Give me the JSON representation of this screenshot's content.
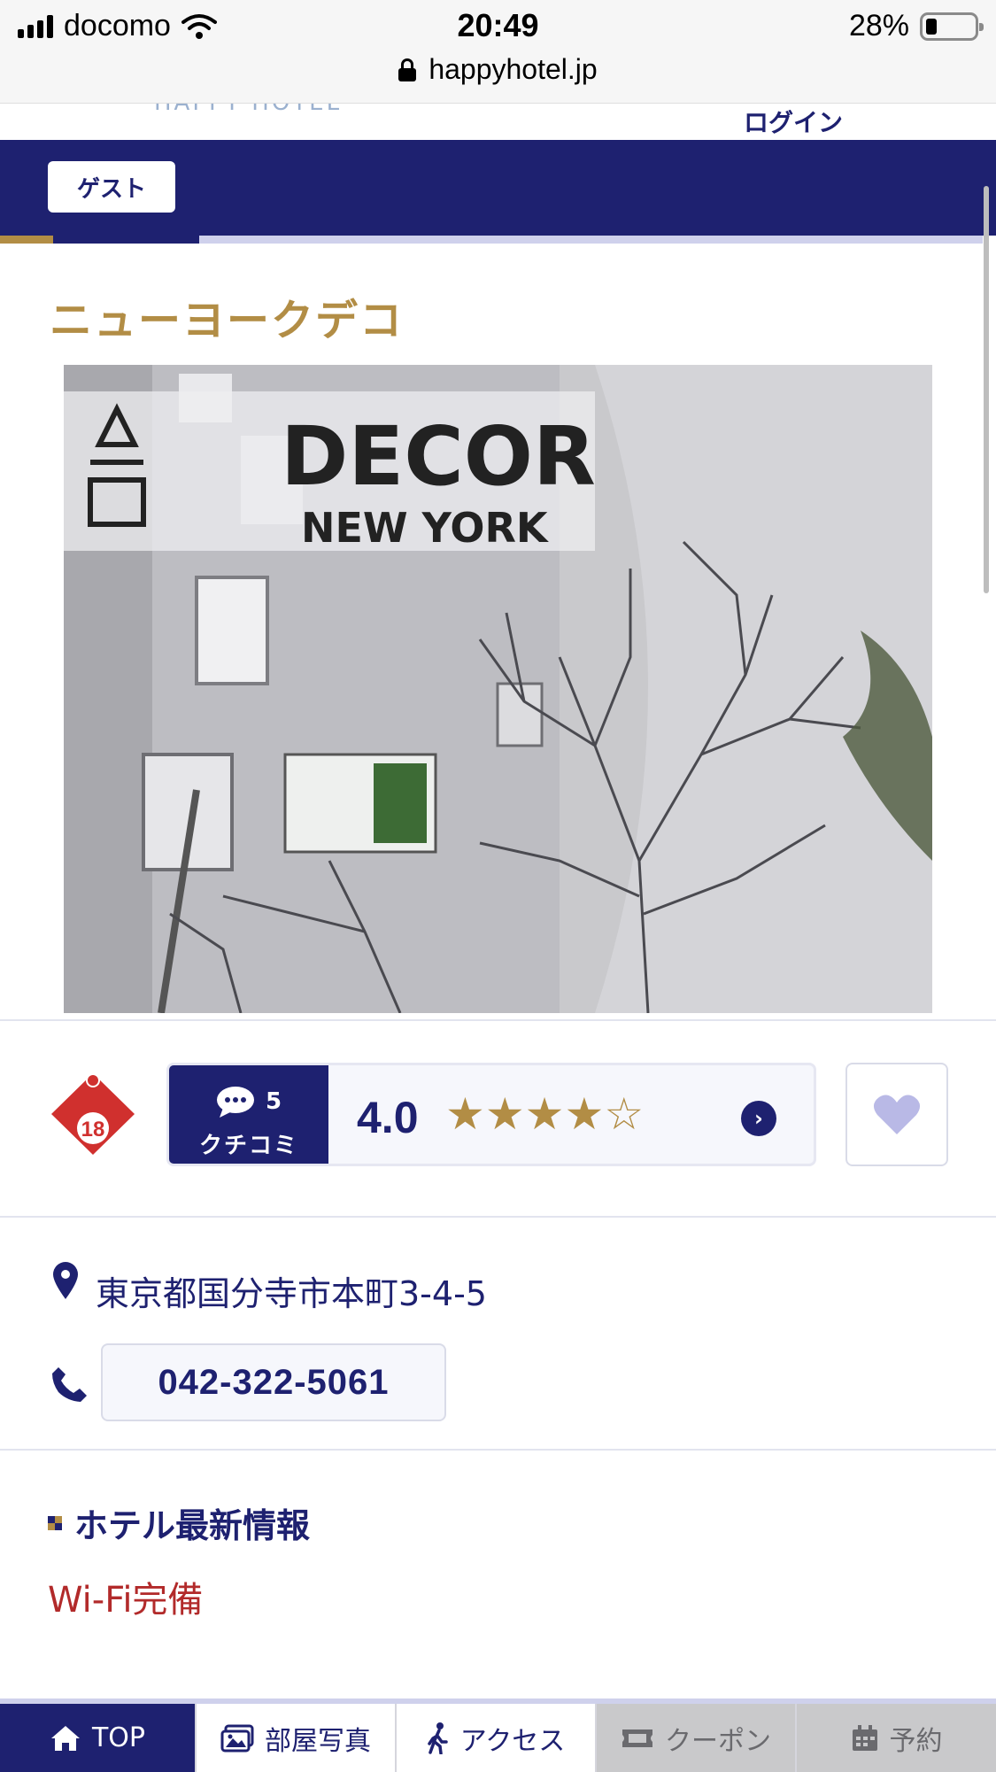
{
  "status_bar": {
    "carrier": "docomo",
    "time": "20:49",
    "battery_percent": "28%",
    "battery_level": 0.28,
    "url": "happyhotel.jp"
  },
  "header": {
    "logo_text": "HAPPY HOTEL",
    "login_label": "ログイン"
  },
  "nav": {
    "guest_label": "ゲスト"
  },
  "hotel": {
    "name": "ニューヨークデコ",
    "photo_sign_line1": "DECOR",
    "photo_sign_line2": "NEW YORK"
  },
  "rating": {
    "age_badge": "18",
    "review_count": "5",
    "review_label": "クチコミ",
    "score": "4.0",
    "stars_filled": 4,
    "stars_total": 5
  },
  "contact": {
    "address": "東京都国分寺市本町3-4-5",
    "phone": "042-322-5061"
  },
  "latest_info": {
    "title": "ホテル最新情報",
    "text": "Wi-Fi完備"
  },
  "tabs": [
    {
      "label": "TOP",
      "icon": "home-icon",
      "state": "active"
    },
    {
      "label": "部屋写真",
      "icon": "photo-icon",
      "state": "normal"
    },
    {
      "label": "アクセス",
      "icon": "walk-icon",
      "state": "normal"
    },
    {
      "label": "クーポン",
      "icon": "ticket-icon",
      "state": "disabled"
    },
    {
      "label": "予約",
      "icon": "calendar-icon",
      "state": "disabled"
    }
  ],
  "colors": {
    "navy": "#1e2170",
    "gold": "#b28d45",
    "info_red": "#b22a2a",
    "disabled_tab": "#c9c9cb",
    "heart": "#b9b9e6"
  }
}
